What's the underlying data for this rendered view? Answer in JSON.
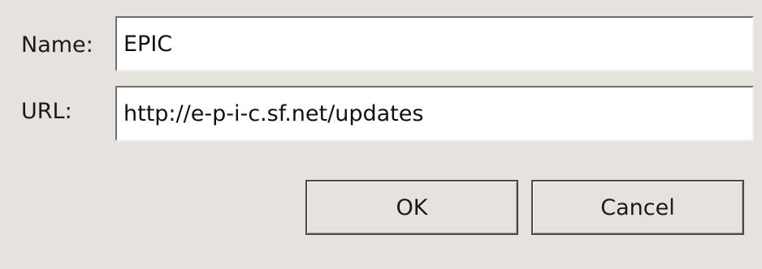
{
  "form": {
    "name_label": "Name:",
    "name_value": "EPIC",
    "url_label": "URL:",
    "url_value": "http://e-p-i-c.sf.net/updates"
  },
  "buttons": {
    "ok": "OK",
    "cancel": "Cancel"
  },
  "colors": {
    "dialog_bg": "#e6e3df",
    "field_bg": "#ffffff",
    "text": "#1a1a1a"
  }
}
